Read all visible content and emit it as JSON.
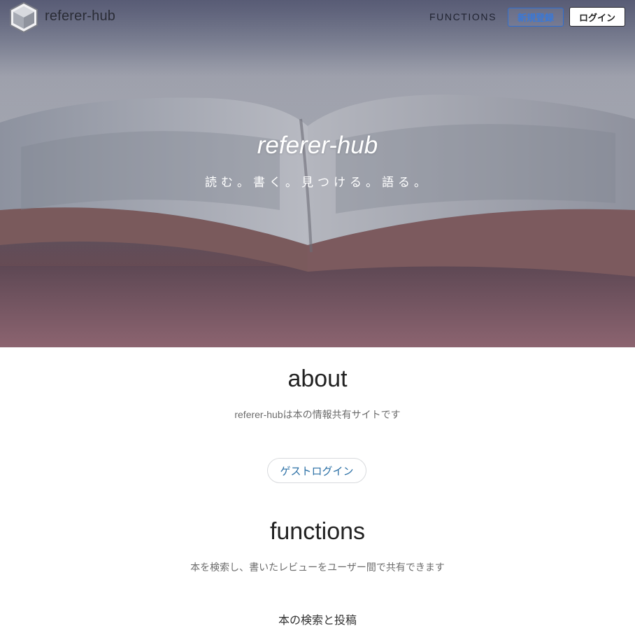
{
  "nav": {
    "brand": "referer-hub",
    "functions_link": "FUNCTIONS",
    "signup_label": "新規登録",
    "login_label": "ログイン"
  },
  "hero": {
    "title": "referer-hub",
    "tagline": "読む。書く。見つける。語る。"
  },
  "about": {
    "title": "about",
    "description": "referer-hubは本の情報共有サイトです",
    "guest_login_label": "ゲストログイン"
  },
  "functions": {
    "title": "functions",
    "description": "本を検索し、書いたレビューをユーザー間で共有できます",
    "features": [
      "本の検索と投稿"
    ]
  },
  "colors": {
    "accent_blue": "#3a78d6",
    "link_blue": "#2a6fa5"
  },
  "icons": [
    "cube-logo-icon"
  ]
}
